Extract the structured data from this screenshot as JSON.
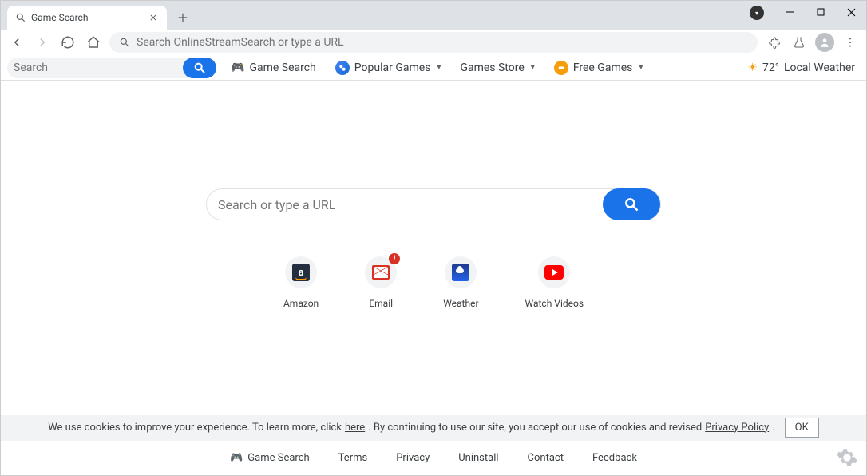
{
  "tab": {
    "title": "Game Search"
  },
  "omnibox": {
    "placeholder": "Search OnlineStreamSearch or type a URL"
  },
  "bookmarks": {
    "search_placeholder": "Search",
    "game_search": "Game Search",
    "popular_games": "Popular Games",
    "games_store": "Games Store",
    "free_games": "Free Games",
    "weather_temp": "72°",
    "weather_label": "Local Weather"
  },
  "main": {
    "search_placeholder": "Search or type a URL",
    "shortcuts": [
      {
        "label": "Amazon"
      },
      {
        "label": "Email",
        "badge": "!"
      },
      {
        "label": "Weather"
      },
      {
        "label": "Watch Videos"
      }
    ]
  },
  "cookie": {
    "text_before": "We use cookies to improve your experience. To learn more, click ",
    "here": "here",
    "text_mid": ". By continuing to use our site, you accept our use of cookies and revised ",
    "privacy": "Privacy Policy",
    "text_end": ".",
    "ok": "OK"
  },
  "footer": {
    "game_search": "Game Search",
    "terms": "Terms",
    "privacy": "Privacy",
    "uninstall": "Uninstall",
    "contact": "Contact",
    "feedback": "Feedback"
  }
}
